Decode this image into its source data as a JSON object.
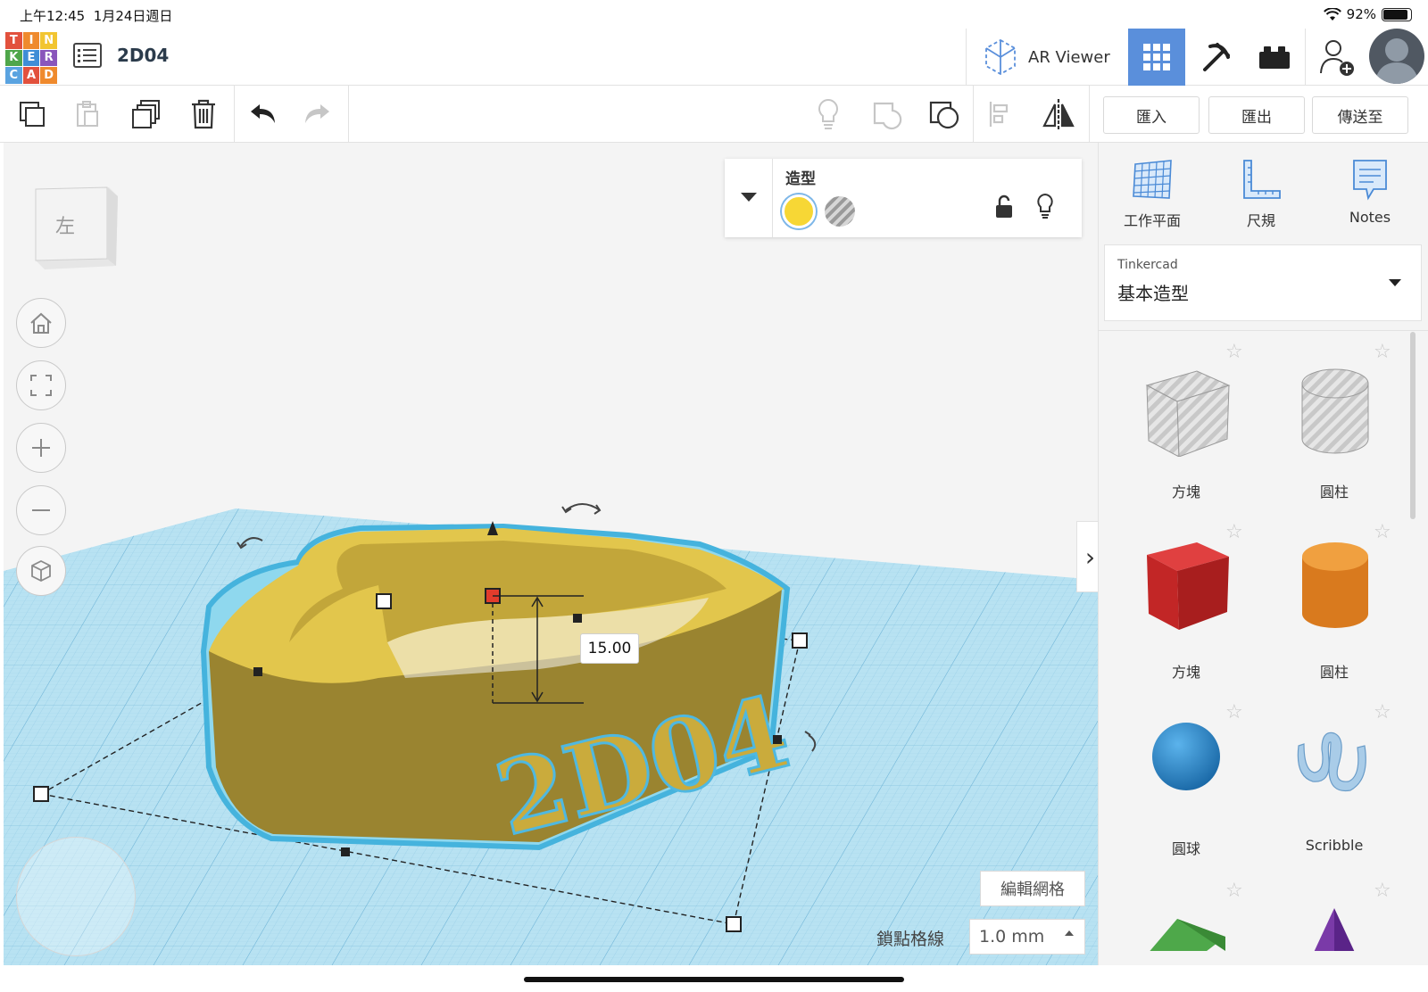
{
  "status_bar": {
    "time": "上午12:45",
    "date": "1月24日週日",
    "battery": "92%"
  },
  "header": {
    "logo_letters": [
      "T",
      "I",
      "N",
      "K",
      "E",
      "R",
      "C",
      "A",
      "D"
    ],
    "logo_colors": [
      "#e2513d",
      "#ef8a2d",
      "#f2c531",
      "#4fa64a",
      "#3f8ed6",
      "#8a56bb",
      "#5aa3e0",
      "#e2513d",
      "#ef8a2d"
    ],
    "project_title": "2D04",
    "ar_viewer_label": "AR Viewer"
  },
  "toolbar": {
    "import_label": "匯入",
    "export_label": "匯出",
    "send_label": "傳送至"
  },
  "inspector": {
    "title": "造型",
    "solid_color": "#f7d735"
  },
  "viewcube": {
    "face_label": "左"
  },
  "workplane": {
    "dimension_value": "15.00",
    "object_text": "2D04",
    "edit_grid_label": "編輯網格",
    "snap_label": "鎖點格線",
    "snap_value": "1.0 mm"
  },
  "right_panel": {
    "tools": [
      {
        "label": "工作平面",
        "icon": "workplane-icon"
      },
      {
        "label": "尺規",
        "icon": "ruler-icon"
      },
      {
        "label": "Notes",
        "icon": "notes-icon"
      }
    ],
    "library_source": "Tinkercad",
    "library_name": "基本造型",
    "shapes": [
      {
        "label": "方塊",
        "icon": "box-hole-icon"
      },
      {
        "label": "圓柱",
        "icon": "cylinder-hole-icon"
      },
      {
        "label": "方塊",
        "icon": "box-icon"
      },
      {
        "label": "圓柱",
        "icon": "cylinder-icon"
      },
      {
        "label": "圓球",
        "icon": "sphere-icon"
      },
      {
        "label": "Scribble",
        "icon": "scribble-icon"
      }
    ]
  },
  "colors": {
    "accent": "#5a8fdb",
    "object_yellow": "#d4b83e",
    "grid_blue": "#a8d8ec"
  }
}
